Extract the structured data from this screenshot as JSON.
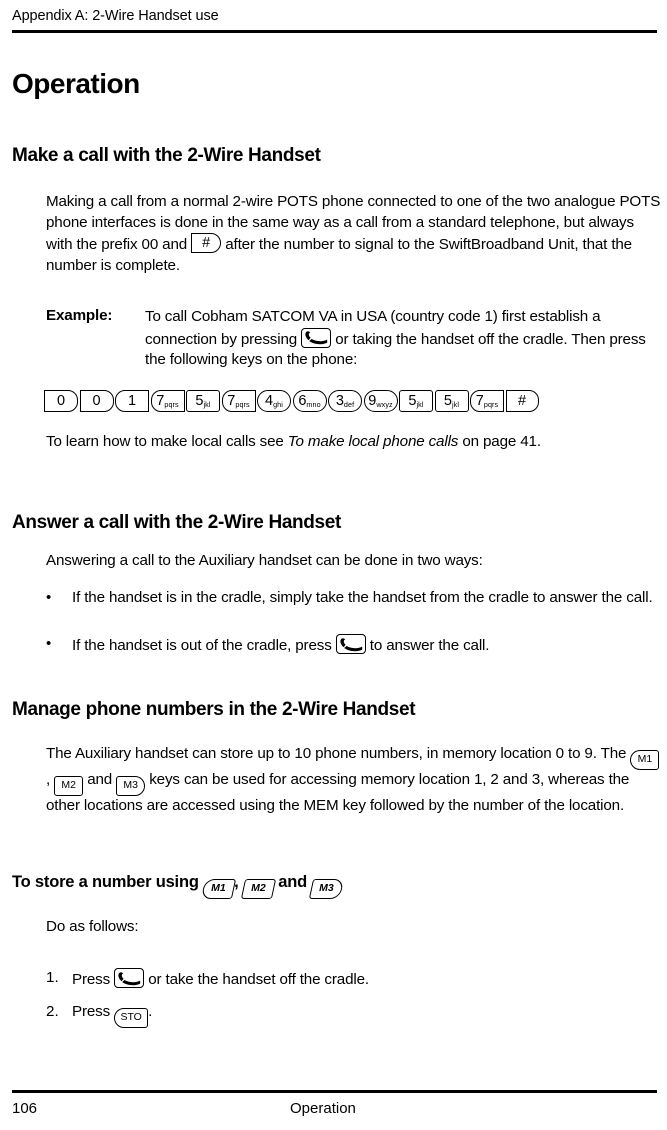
{
  "header": {
    "running_head": "Appendix A:  2-Wire Handset use"
  },
  "footer": {
    "page_number": "106",
    "section": "Operation"
  },
  "title": "Operation",
  "sections": [
    {
      "heading": "Make a call with the 2-Wire Handset",
      "paragraph_1a": "Making a call from a normal 2-wire POTS phone connected to one of the two analogue POTS phone interfaces is done in the same way as a call from a standard telephone, but always with the prefix 00 and ",
      "paragraph_1b": " after the number to signal to the SwiftBroadband Unit, that the number is complete.",
      "inline_key_hash": "#",
      "example_label": "Example:",
      "example_text_a": "To call Cobham SATCOM VA in USA (country code 1) first establish a connection by pressing ",
      "example_text_b": " or taking the handset off the cradle. Then press the following keys on the phone:",
      "keypad_sequence": [
        {
          "digit": "0",
          "letters": "",
          "shape": "flat-left-round-right"
        },
        {
          "digit": "0",
          "letters": "",
          "shape": "flat-left-round-right"
        },
        {
          "digit": "1",
          "letters": "",
          "shape": "round-left-flat-right"
        },
        {
          "digit": "7",
          "letters": "pqrs",
          "shape": "round-left-flat-right"
        },
        {
          "digit": "5",
          "letters": "jkl",
          "shape": "rectangular"
        },
        {
          "digit": "7",
          "letters": "pqrs",
          "shape": "round-left-flat-right"
        },
        {
          "digit": "4",
          "letters": "ghi",
          "shape": "oval"
        },
        {
          "digit": "6",
          "letters": "mno",
          "shape": "oval"
        },
        {
          "digit": "3",
          "letters": "def",
          "shape": "oval"
        },
        {
          "digit": "9",
          "letters": "wxyz",
          "shape": "oval"
        },
        {
          "digit": "5",
          "letters": "jkl",
          "shape": "rectangular"
        },
        {
          "digit": "5",
          "letters": "jkl",
          "shape": "rectangular"
        },
        {
          "digit": "7",
          "letters": "pqrs",
          "shape": "round-left-flat-right"
        },
        {
          "digit": "#",
          "letters": "",
          "shape": "flat-left-round-right"
        }
      ],
      "cross_reference_a": "To learn how to make local calls see ",
      "cross_reference_italic": "To make local phone calls",
      "cross_reference_b": " on page 41."
    },
    {
      "heading": "Answer a call with the 2-Wire Handset",
      "intro": "Answering a call to the Auxiliary handset can be done in two ways:",
      "bullet_mark": "•",
      "bullets": [
        {
          "text": "If the handset is in the cradle, simply take the handset from the cradle to answer the call."
        },
        {
          "text_a": "If the handset is out of the cradle, press ",
          "text_b": " to answer the call."
        }
      ]
    },
    {
      "heading": "Manage phone numbers in the 2-Wire Handset",
      "paragraph_a": "The Auxiliary handset can store up to 10 phone numbers, in memory location 0 to 9. The ",
      "paragraph_b": ", ",
      "paragraph_c": " and ",
      "paragraph_d": " keys can be used for accessing memory location 1, 2 and 3, whereas the other locations are accessed using the MEM key followed by the number of the location.",
      "memory_keys": [
        "M1",
        "M2",
        "M3"
      ]
    },
    {
      "subheading_a": "To store a number using ",
      "subheading_comma": ",",
      "subheading_and": " and ",
      "subheading_keys": [
        "M1",
        "M2",
        "M3"
      ],
      "intro": "Do as follows:",
      "steps": [
        {
          "mark": "1.",
          "text_a": "Press ",
          "text_b": " or take the handset off the cradle."
        },
        {
          "mark": "2.",
          "text_a": "Press ",
          "text_b": "."
        }
      ],
      "sto_key": "STO"
    }
  ],
  "icons": {
    "phone_handset": "phone-handset-icon"
  }
}
